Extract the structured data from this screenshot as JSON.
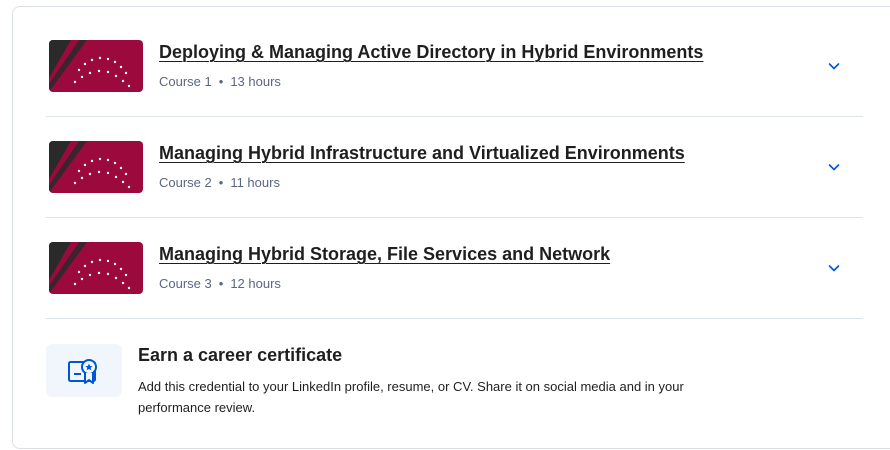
{
  "courses": [
    {
      "title": "Deploying & Managing Active Directory in Hybrid Environments",
      "course_label": "Course 1",
      "separator": "•",
      "duration": "13 hours"
    },
    {
      "title": "Managing Hybrid Infrastructure and Virtualized Environments",
      "course_label": "Course 2",
      "separator": "•",
      "duration": "11 hours"
    },
    {
      "title": "Managing Hybrid Storage, File Services and Network",
      "course_label": "Course 3",
      "separator": "•",
      "duration": "12 hours"
    }
  ],
  "certificate": {
    "title": "Earn a career certificate",
    "description": "Add this credential to your LinkedIn profile, resume, or CV. Share it on social media and in your performance review."
  },
  "icons": {
    "expand": "chevron-down-icon",
    "certificate": "certificate-icon",
    "thumbnail": "course-thumbnail"
  },
  "colors": {
    "thumb_crimson": "#9c0a3d",
    "thumb_dark": "#2a2a2a",
    "link_blue": "#0056d2",
    "meta_gray": "#5b6780",
    "divider": "#dde3ea",
    "cert_bg": "#f0f6fc"
  }
}
